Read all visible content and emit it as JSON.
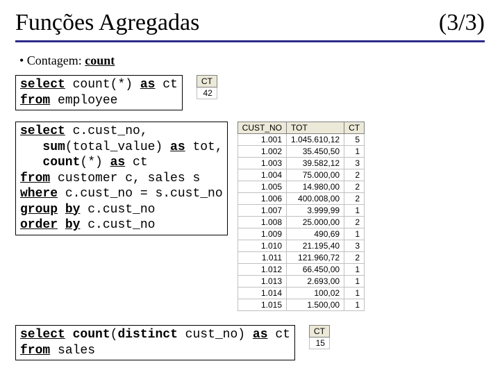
{
  "title_left": "Funções Agregadas",
  "title_right": "(3/3)",
  "subhead_prefix": "• Contagem: ",
  "subhead_kw": "count",
  "code1": {
    "p0a": "select",
    "p0b": " count(*) ",
    "p0c": "as",
    "p0d": " ct",
    "p1a": "from",
    "p1b": " employee"
  },
  "table1": {
    "h0": "CT",
    "v0": "42"
  },
  "code2": {
    "l0a": "select",
    "l0b": " c.cust_no,",
    "l1a": "sum",
    "l1b": "(total_value) ",
    "l1c": "as",
    "l1d": " tot,",
    "l2a": "count",
    "l2b": "(*) ",
    "l2c": "as",
    "l2d": " ct",
    "l3a": "from",
    "l3b": " customer c, sales s",
    "l4a": "where",
    "l4b": " c.cust_no = s.cust_no",
    "l5a": "group",
    "l5b": "by",
    "l5c": " c.cust_no",
    "l6a": "order",
    "l6b": "by",
    "l6c": " c.cust_no"
  },
  "table2": {
    "headers": [
      "CUST_NO",
      "TOT",
      "CT"
    ],
    "rows": [
      [
        "1.001",
        "1.045.610,12",
        "5"
      ],
      [
        "1.002",
        "35.450,50",
        "1"
      ],
      [
        "1.003",
        "39.582,12",
        "3"
      ],
      [
        "1.004",
        "75.000,00",
        "2"
      ],
      [
        "1.005",
        "14.980,00",
        "2"
      ],
      [
        "1.006",
        "400.008,00",
        "2"
      ],
      [
        "1.007",
        "3.999,99",
        "1"
      ],
      [
        "1.008",
        "25.000,00",
        "2"
      ],
      [
        "1.009",
        "490,69",
        "1"
      ],
      [
        "1.010",
        "21.195,40",
        "3"
      ],
      [
        "1.011",
        "121.960,72",
        "2"
      ],
      [
        "1.012",
        "66.450,00",
        "1"
      ],
      [
        "1.013",
        "2.693,00",
        "1"
      ],
      [
        "1.014",
        "100,02",
        "1"
      ],
      [
        "1.015",
        "1.500,00",
        "1"
      ]
    ]
  },
  "code3": {
    "p0a": "select",
    "p0b": " ",
    "p0c": "count",
    "p0d": "(",
    "p0e": "distinct",
    "p0f": " cust_no) ",
    "p0g": "as",
    "p0h": " ct",
    "p1a": "from",
    "p1b": " sales"
  },
  "table3": {
    "h0": "CT",
    "v0": "15"
  }
}
